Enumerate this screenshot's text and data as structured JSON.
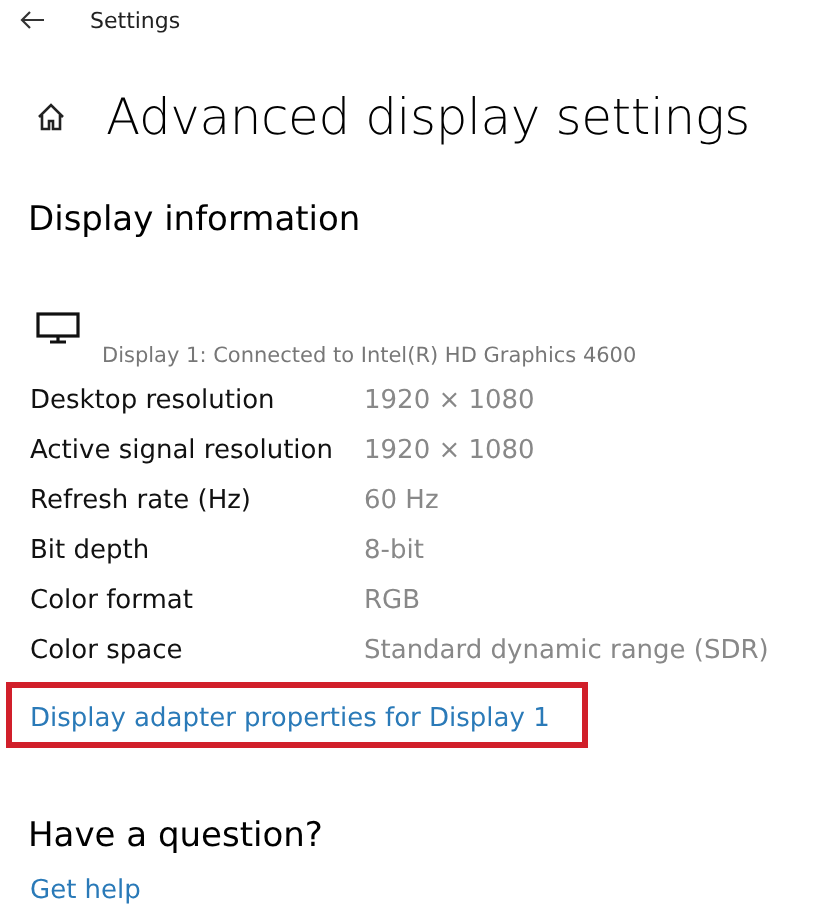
{
  "window": {
    "title": "Settings"
  },
  "page": {
    "title": "Advanced display settings"
  },
  "display_information": {
    "heading": "Display information",
    "display_name": "Display 1: Connected to Intel(R) HD Graphics 4600",
    "rows": [
      {
        "label": "Desktop resolution",
        "value": "1920 × 1080"
      },
      {
        "label": "Active signal resolution",
        "value": "1920 × 1080"
      },
      {
        "label": "Refresh rate (Hz)",
        "value": "60 Hz"
      },
      {
        "label": "Bit depth",
        "value": "8-bit"
      },
      {
        "label": "Color format",
        "value": "RGB"
      },
      {
        "label": "Color space",
        "value": "Standard dynamic range (SDR)"
      }
    ],
    "adapter_link": {
      "label": "Display adapter properties for Display 1",
      "highlighted": true
    }
  },
  "help": {
    "heading": "Have a question?",
    "link": "Get help"
  }
}
